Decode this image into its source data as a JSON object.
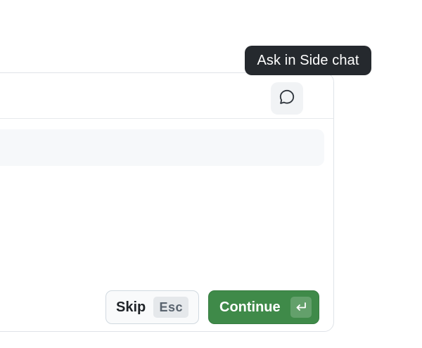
{
  "tooltip": {
    "text": "Ask in Side chat"
  },
  "header": {
    "chat_icon": "speech-bubble-icon"
  },
  "actions": {
    "skip_label": "Skip",
    "skip_shortcut": "Esc",
    "continue_label": "Continue",
    "continue_shortcut_icon": "return-key-icon"
  },
  "colors": {
    "tooltip_bg": "#25292e",
    "continue_bg": "#3f8a49",
    "input_bg": "#f6f8fa"
  }
}
